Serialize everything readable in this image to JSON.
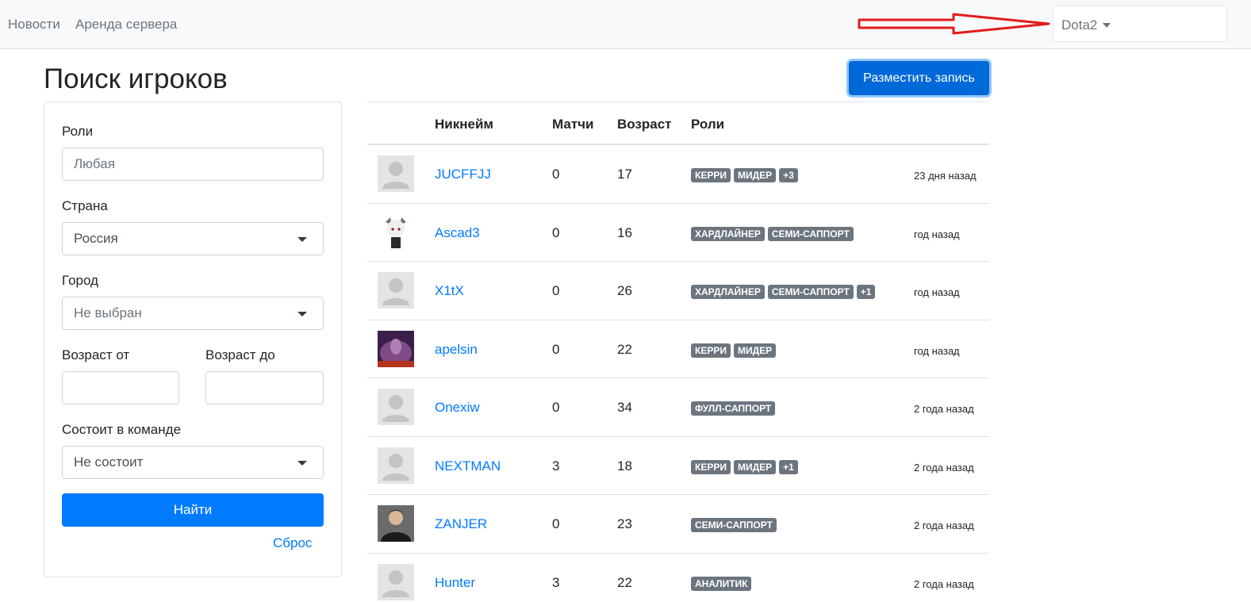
{
  "navbar": {
    "links": [
      "Новости",
      "Аренда сервера"
    ],
    "game_select": "Dota2"
  },
  "page": {
    "title": "Поиск игроков",
    "post_button": "Разместить запись"
  },
  "filters": {
    "roles_label": "Роли",
    "roles_placeholder": "Любая",
    "country_label": "Страна",
    "country_value": "Россия",
    "city_label": "Город",
    "city_value": "Не выбран",
    "age_from_label": "Возраст от",
    "age_to_label": "Возраст до",
    "team_label": "Состоит в команде",
    "team_value": "Не состоит",
    "find_button": "Найти",
    "reset_link": "Сброс"
  },
  "table": {
    "columns": [
      "Никнейм",
      "Матчи",
      "Возраст",
      "Роли"
    ],
    "rows": [
      {
        "avatar": "default-avatar",
        "nickname": "JUCFFJJ",
        "matches": "0",
        "age": "17",
        "roles": [
          "КЕРРИ",
          "МИДЕР",
          "+3"
        ],
        "time": "23 дня назад"
      },
      {
        "avatar": "anime-avatar",
        "nickname": "Ascad3",
        "matches": "0",
        "age": "16",
        "roles": [
          "ХАРДЛАЙНЕР",
          "СЕМИ-САППОРТ"
        ],
        "time": "год назад"
      },
      {
        "avatar": "default-avatar",
        "nickname": "X1tX",
        "matches": "0",
        "age": "26",
        "roles": [
          "ХАРДЛАЙНЕР",
          "СЕМИ-САППОРТ",
          "+1"
        ],
        "time": "год назад"
      },
      {
        "avatar": "purple-avatar",
        "nickname": "apelsin",
        "matches": "0",
        "age": "22",
        "roles": [
          "КЕРРИ",
          "МИДЕР"
        ],
        "time": "год назад"
      },
      {
        "avatar": "default-avatar",
        "nickname": "Onexiw",
        "matches": "0",
        "age": "34",
        "roles": [
          "ФУЛЛ-САППОРТ"
        ],
        "time": "2 года назад"
      },
      {
        "avatar": "default-avatar",
        "nickname": "NEXTMAN",
        "matches": "3",
        "age": "18",
        "roles": [
          "КЕРРИ",
          "МИДЕР",
          "+1"
        ],
        "time": "2 года назад"
      },
      {
        "avatar": "photo-avatar",
        "nickname": "ZANJER",
        "matches": "0",
        "age": "23",
        "roles": [
          "СЕМИ-САППОРТ"
        ],
        "time": "2 года назад"
      },
      {
        "avatar": "default-avatar",
        "nickname": "Hunter",
        "matches": "3",
        "age": "22",
        "roles": [
          "АНАЛИТИК"
        ],
        "time": "2 года назад"
      }
    ]
  },
  "colors": {
    "primary": "#007bff",
    "badge": "#6c757d",
    "annotation_arrow": "#e31b1b"
  }
}
